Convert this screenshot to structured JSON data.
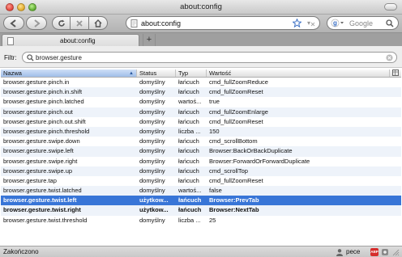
{
  "window": {
    "title": "about:config"
  },
  "toolbar": {
    "url": "about:config",
    "search_placeholder": "Google",
    "star_icon": "star-icon",
    "back_icon": "back-arrow-icon",
    "forward_icon": "forward-arrow-icon"
  },
  "tab": {
    "label": "about:config"
  },
  "filter": {
    "label": "Filtr:",
    "value": "browser.gesture"
  },
  "table": {
    "columns": [
      "Nazwa",
      "Status",
      "Typ",
      "Wartość"
    ],
    "rows": [
      [
        "browser.gesture.pinch.in",
        "domyślny",
        "łańcuch",
        "cmd_fullZoomReduce"
      ],
      [
        "browser.gesture.pinch.in.shift",
        "domyślny",
        "łańcuch",
        "cmd_fullZoomReset"
      ],
      [
        "browser.gesture.pinch.latched",
        "domyślny",
        "wartoś...",
        "true"
      ],
      [
        "browser.gesture.pinch.out",
        "domyślny",
        "łańcuch",
        "cmd_fullZoomEnlarge"
      ],
      [
        "browser.gesture.pinch.out.shift",
        "domyślny",
        "łańcuch",
        "cmd_fullZoomReset"
      ],
      [
        "browser.gesture.pinch.threshold",
        "domyślny",
        "liczba ...",
        "150"
      ],
      [
        "browser.gesture.swipe.down",
        "domyślny",
        "łańcuch",
        "cmd_scrollBottom"
      ],
      [
        "browser.gesture.swipe.left",
        "domyślny",
        "łańcuch",
        "Browser:BackOrBackDuplicate"
      ],
      [
        "browser.gesture.swipe.right",
        "domyślny",
        "łańcuch",
        "Browser:ForwardOrForwardDuplicate"
      ],
      [
        "browser.gesture.swipe.up",
        "domyślny",
        "łańcuch",
        "cmd_scrollTop"
      ],
      [
        "browser.gesture.tap",
        "domyślny",
        "łańcuch",
        "cmd_fullZoomReset"
      ],
      [
        "browser.gesture.twist.latched",
        "domyślny",
        "wartoś...",
        "false"
      ],
      [
        "browser.gesture.twist.left",
        "użytkow...",
        "łańcuch",
        "Browser:PrevTab"
      ],
      [
        "browser.gesture.twist.right",
        "użytkow...",
        "łańcuch",
        "Browser:NextTab"
      ],
      [
        "browser.gesture.twist.threshold",
        "domyślny",
        "liczba ...",
        "25"
      ]
    ],
    "selected_row": 12,
    "user_set_rows": [
      12,
      13
    ]
  },
  "status": {
    "text": "Zakończono",
    "user": "pece",
    "addon_badge": "ABP"
  },
  "colors": {
    "selection": "#3875d7",
    "sort_header": "#9fbde8"
  }
}
